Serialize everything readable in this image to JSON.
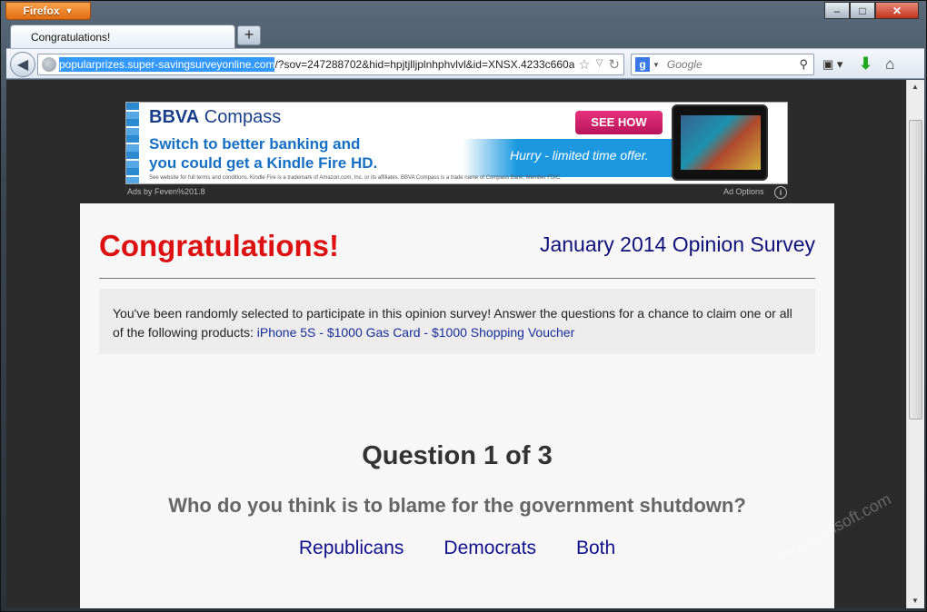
{
  "browser": {
    "menu_label": "Firefox",
    "tab_title": "Congratulations!",
    "new_tab": "+",
    "url_host": "popularprizes.super-savingsurveyonline.com",
    "url_rest": "/?sov=247288702&hid=hpjtjlljplnhphvlvl&id=XNSX.4233c660a",
    "search_placeholder": "Google",
    "search_engine_letter": "g"
  },
  "ad": {
    "brand_bold": "BBVA",
    "brand_rest": " Compass",
    "cta": "SEE HOW",
    "headline_line1": "Switch to better banking and",
    "headline_line2": "you could get a Kindle Fire HD.",
    "hurry": "Hurry - limited time offer.",
    "fine_print": "See website for full terms and conditions. Kindle Fire is a trademark of Amazon.com, Inc. or its affiliates. BBVA Compass is a trade name of Compass Bank, Member FDIC.",
    "ads_by": "Ads by Feven%201.8",
    "ad_options": "Ad Options"
  },
  "survey": {
    "congrats": "Congratulations!",
    "title": "January 2014 Opinion Survey",
    "intro": "You've been randomly selected to participate in this opinion survey! Answer the questions for a chance to claim one or all of the following products: ",
    "products": "iPhone 5S - $1000 Gas Card - $1000 Shopping Voucher",
    "question_heading": "Question 1 of 3",
    "question": "Who do you think is to blame for the government shutdown?",
    "answers": [
      "Republicans",
      "Democrats",
      "Both"
    ]
  },
  "watermark": "www.anvisoft.com"
}
